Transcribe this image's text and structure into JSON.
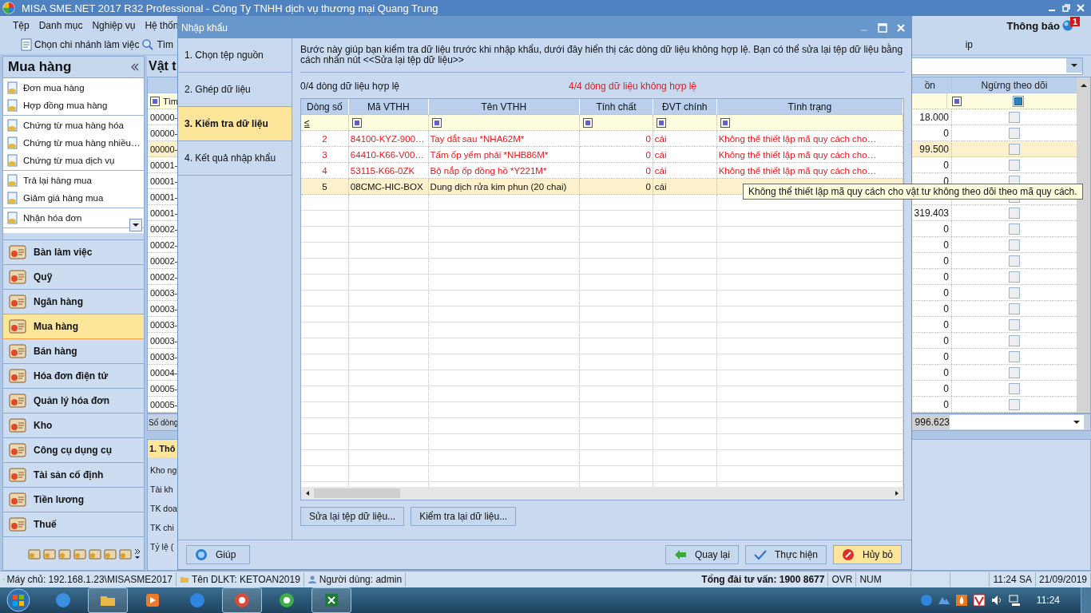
{
  "app_title": "MISA SME.NET 2017 R32 Professional - Công Ty TNHH dịch vụ thương mại Quang Trung",
  "menu": [
    "Tệp",
    "Danh mục",
    "Nghiệp vụ",
    "Hệ thốn"
  ],
  "menu_partial": "ip",
  "notification": {
    "label": "Thông báo",
    "count": "1"
  },
  "toolbar": {
    "branch": "Chọn chi nhánh làm việc",
    "search": "Tìm"
  },
  "sidebar": {
    "title": "Mua hàng",
    "groups": [
      [
        "Đơn mua hàng",
        "Hợp đồng mua hàng"
      ],
      [
        "Chứng từ mua hàng hóa",
        "Chứng từ mua hàng nhiều…",
        "Chứng từ mua dịch vụ"
      ],
      [
        "Trả lại hàng mua",
        "Giảm giá hàng mua"
      ],
      [
        "Nhận hóa đơn"
      ]
    ],
    "modules": [
      {
        "label": "Bàn làm việc",
        "selected": false
      },
      {
        "label": "Quỹ",
        "selected": false
      },
      {
        "label": "Ngân hàng",
        "selected": false
      },
      {
        "label": "Mua hàng",
        "selected": true
      },
      {
        "label": "Bán hàng",
        "selected": false
      },
      {
        "label": "Hóa đơn điện tử",
        "selected": false
      },
      {
        "label": "Quản lý hóa đơn",
        "selected": false
      },
      {
        "label": "Kho",
        "selected": false
      },
      {
        "label": "Công cụ dụng cụ",
        "selected": false
      },
      {
        "label": "Tài sản cố định",
        "selected": false
      },
      {
        "label": "Tiền lương",
        "selected": false
      },
      {
        "label": "Thuế",
        "selected": false
      }
    ]
  },
  "background": {
    "title": "Vật t",
    "filter_label": "Tìm",
    "columns": [
      "ồn",
      "Ngừng theo dõi"
    ],
    "rows": [
      {
        "code": "00000-",
        "value": "18.000",
        "checked": false,
        "selected": false
      },
      {
        "code": "00000-",
        "value": "0",
        "checked": false,
        "selected": false
      },
      {
        "code": "00000-",
        "value": "99.500",
        "checked": false,
        "selected": true
      },
      {
        "code": "00001-",
        "value": "0",
        "checked": false,
        "selected": false
      },
      {
        "code": "00001-",
        "value": "0",
        "checked": false,
        "selected": false
      },
      {
        "code": "00001-",
        "checked": false,
        "selected": false
      },
      {
        "code": "00001-",
        "value": "319.403",
        "checked": false,
        "selected": false
      },
      {
        "code": "00002-",
        "value": "0",
        "checked": false,
        "selected": false
      },
      {
        "code": "00002-",
        "value": "0",
        "checked": false,
        "selected": false
      },
      {
        "code": "00002-",
        "value": "0",
        "checked": false,
        "selected": false
      },
      {
        "code": "00002-",
        "value": "0",
        "checked": false,
        "selected": false
      },
      {
        "code": "00003-",
        "value": "0",
        "checked": false,
        "selected": false
      },
      {
        "code": "00003-",
        "value": "0",
        "checked": false,
        "selected": false
      },
      {
        "code": "00003-",
        "value": "0",
        "checked": false,
        "selected": false
      },
      {
        "code": "00003-",
        "value": "0",
        "checked": false,
        "selected": false
      },
      {
        "code": "00003-",
        "value": "0",
        "checked": false,
        "selected": false
      },
      {
        "code": "00004-",
        "value": "0",
        "checked": false,
        "selected": false
      },
      {
        "code": "00005-",
        "value": "0",
        "checked": false,
        "selected": false
      },
      {
        "code": "00005-",
        "value": "0",
        "checked": false,
        "selected": false
      }
    ],
    "footer_label": "Số dòng",
    "footer_total": "996.623",
    "panel_tab": "1. Thô",
    "panel_labels": [
      "Kho ng",
      "Tài kh",
      "TK doa",
      "TK chi",
      "Tỷ lệ ("
    ]
  },
  "dialog": {
    "title": "Nhập khẩu",
    "steps": [
      {
        "label": "1. Chọn tệp nguồn",
        "selected": false
      },
      {
        "label": "2. Ghép dữ liệu",
        "selected": false
      },
      {
        "label": "3. Kiểm tra dữ liệu",
        "selected": true
      },
      {
        "label": "4. Kết quả nhập khẩu",
        "selected": false
      }
    ],
    "description": "Bước này giúp bạn kiểm tra dữ liệu trước khi nhập khẩu, dưới đây hiển thị các dòng dữ liệu không hợp lệ. Bạn có thể sửa lại tệp dữ liệu bằng cách nhấn nút <<Sửa lại tệp dữ liệu>>",
    "valid_count": "0/4 dòng dữ liệu hợp lệ",
    "invalid_count": "4/4 dòng dữ liệu không hợp lệ",
    "columns": [
      "Dòng số",
      "Mã VTHH",
      "Tên VTHH",
      "Tính chất",
      "ĐVT chính",
      "Tình trạng"
    ],
    "filter_operator": "≤",
    "rows": [
      {
        "line": "2",
        "code": "84100-KYZ-900…",
        "name": "Tay dắt sau *NHA62M*",
        "property": "0",
        "unit": "cái",
        "status": "Không thể thiết lập mã quy cách cho…",
        "selected": false
      },
      {
        "line": "3",
        "code": "64410-K66-V00…",
        "name": "Tấm ốp yếm phải *NHB86M*",
        "property": "0",
        "unit": "cái",
        "status": "Không thể thiết lập mã quy cách cho…",
        "selected": false
      },
      {
        "line": "4",
        "code": "53115-K66-0ZK",
        "name": "Bộ nắp ốp đồng hồ *Y221M*",
        "property": "0",
        "unit": "cái",
        "status": "Không thể thiết lập mã quy cách cho…",
        "selected": false
      },
      {
        "line": "5",
        "code": "08CMC-HIC-BOX",
        "name": "Dung dịch rửa kim phun (20 chai)",
        "property": "0",
        "unit": "cái",
        "selected": true
      }
    ],
    "tooltip": "Không thể thiết lập mã quy cách cho vật tư không theo dõi theo mã quy cách.",
    "actions": [
      "Sửa lại tệp dữ liệu...",
      "Kiểm tra lại dữ liệu..."
    ],
    "help": "Giúp",
    "back": "Quay lại",
    "run": "Thực hiện",
    "cancel": "Hủy bỏ"
  },
  "status_bar": {
    "server": "Máy chủ: 192.168.1.23\\MISASME2017",
    "database": "Tên DLKT: KETOAN2019",
    "user": "Người dùng: admin",
    "hotline": "Tổng đài tư vấn: 1900 8677",
    "ovr": "OVR",
    "num": "NUM",
    "time": "11:24 SA",
    "date": "21/09/2019"
  },
  "taskbar": {
    "apps": [
      {
        "kind": "ie",
        "open": false
      },
      {
        "kind": "explorer",
        "open": true
      },
      {
        "kind": "media",
        "open": false
      },
      {
        "kind": "chat",
        "open": false
      },
      {
        "kind": "misa",
        "open": true
      },
      {
        "kind": "chrome",
        "open": false
      },
      {
        "kind": "excel",
        "open": true
      }
    ],
    "time": "11:24"
  }
}
